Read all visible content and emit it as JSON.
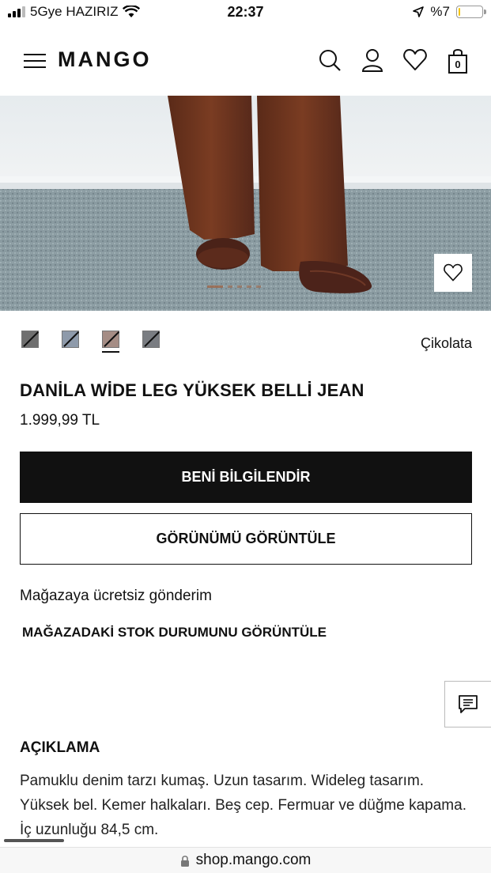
{
  "status_bar": {
    "carrier": "5Gye HAZIRIZ",
    "time": "22:37",
    "battery": "%7",
    "battery_level": 0.07
  },
  "header": {
    "logo": "MANGO",
    "bag_count": "0"
  },
  "product": {
    "color_name": "Çikolata",
    "swatches": [
      {
        "color": "#6f6f6f"
      },
      {
        "color": "#8e9aaa"
      },
      {
        "color": "#a58d85"
      },
      {
        "color": "#7a7d82"
      }
    ],
    "selected_swatch": 2,
    "title": "DANİLA WİDE LEG YÜKSEK BELLİ JEAN",
    "price": "1.999,99 TL"
  },
  "buttons": {
    "notify": "BENİ BİLGİLENDİR",
    "view_look": "GÖRÜNÜMÜ GÖRÜNTÜLE"
  },
  "shipping_text": "Mağazaya ücretsiz gönderim",
  "stock_link": "MAĞAZADAKİ STOK DURUMUNU GÖRÜNTÜLE",
  "description": {
    "heading": "AÇIKLAMA",
    "line1": "Pamuklu denim tarzı kumaş. Uzun tasarım. Wideleg tasarım.",
    "line2": "Yüksek bel. Kemer halkaları. Beş cep. Fermuar ve düğme kapama.",
    "line3": "İç uzunluğu 84,5 cm."
  },
  "url": "shop.mango.com"
}
